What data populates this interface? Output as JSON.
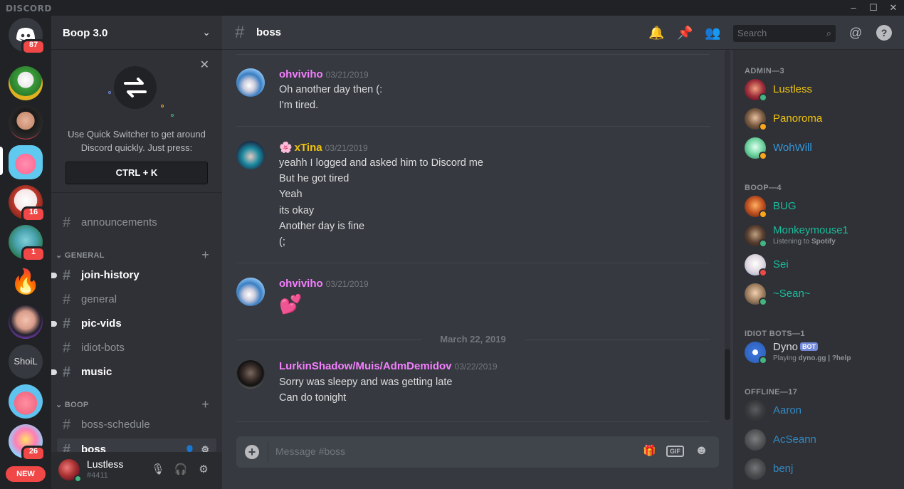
{
  "titlebar": {
    "brand": "DISCORD"
  },
  "rail": {
    "home_badge": "87",
    "badges": [
      "16",
      "1",
      "26"
    ],
    "text_server": "ShoiL",
    "new_label": "NEW"
  },
  "sidebar": {
    "guild_name": "Boop 3.0",
    "switcher": {
      "line1": "Use Quick Switcher to get around",
      "line2": "Discord quickly. Just press:",
      "shortcut": "CTRL + K"
    },
    "channels_top": [
      "announcements"
    ],
    "category_general": "GENERAL",
    "general_channels": [
      "join-history",
      "general",
      "pic-vids",
      "idiot-bots",
      "music"
    ],
    "category_boop": "BOOP",
    "boop_channels": [
      "boss-schedule",
      "boss"
    ],
    "user": {
      "name": "Lustless",
      "tag": "#4411"
    }
  },
  "chat": {
    "channel": "boss",
    "search_placeholder": "Search",
    "messages": [
      {
        "author": "ohviviho",
        "time": "03/21/2019",
        "lines": [
          "Oh another day then (:",
          "I'm tired."
        ]
      },
      {
        "author": "xTina",
        "time": "03/21/2019",
        "lines": [
          "yeahh I logged and asked him to Discord me",
          "But he got tired",
          "Yeah",
          "its okay",
          "Another day is fine",
          "(;"
        ]
      },
      {
        "author": "ohviviho",
        "time": "03/21/2019",
        "lines": [
          "💕"
        ]
      },
      {
        "author": "LurkinShadow/Muis/AdmDemidov",
        "time": "03/22/2019",
        "lines": [
          "Sorry was sleepy and was getting late",
          "Can do tonight"
        ]
      }
    ],
    "date_divider": "March 22, 2019",
    "composer_placeholder": "Message #boss",
    "gif_label": "GIF"
  },
  "members": {
    "groups": [
      {
        "title": "ADMIN—3",
        "members": [
          {
            "name": "Lustless",
            "color": "#f1c40f",
            "status": "on"
          },
          {
            "name": "Panoroma",
            "color": "#f1c40f",
            "status": "idle"
          },
          {
            "name": "WohWill",
            "color": "#3498db",
            "status": "idle"
          }
        ]
      },
      {
        "title": "BOOP—4",
        "members": [
          {
            "name": "BUG",
            "color": "#1abc9c",
            "status": "idle"
          },
          {
            "name": "Monkeymouse1",
            "color": "#1abc9c",
            "status": "on",
            "activity_prefix": "Listening to ",
            "activity": "Spotify"
          },
          {
            "name": "Sei",
            "color": "#1abc9c",
            "status": "dnd"
          },
          {
            "name": "~Sean~",
            "color": "#1abc9c",
            "status": "on"
          }
        ]
      },
      {
        "title": "IDIOT BOTS—1",
        "members": [
          {
            "name": "Dyno",
            "color": "#dcddde",
            "status": "on",
            "bot": "BOT",
            "activity_prefix": "Playing ",
            "activity": "dyno.gg | ?help"
          }
        ]
      },
      {
        "title": "OFFLINE—17",
        "members": [
          {
            "name": "Aaron",
            "color": "#3498db"
          },
          {
            "name": "AcSeann",
            "color": "#3498db"
          },
          {
            "name": "benj",
            "color": "#3498db"
          }
        ]
      }
    ]
  },
  "colors": {
    "pink_author": "#f47fff",
    "accent": "#7289da"
  }
}
